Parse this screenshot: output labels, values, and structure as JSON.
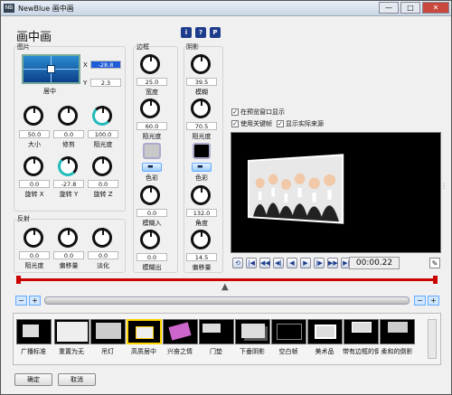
{
  "window": {
    "title": "NewBlue 画中画",
    "buttons": {
      "minimize": "—",
      "maximize": "□",
      "close": "✕"
    }
  },
  "header": {
    "title": "画中画",
    "info": [
      "i",
      "?",
      "P"
    ]
  },
  "picture": {
    "section": "图片",
    "x_label": "X",
    "x_value": "-28.8",
    "y_label": "Y",
    "y_value": "2.3",
    "center_label": "居中",
    "knobs": [
      {
        "value": "50.0",
        "label": "大小"
      },
      {
        "value": "0.0",
        "label": "修剪"
      },
      {
        "value": "100.0",
        "label": "阻光度"
      },
      {
        "value": "0.0",
        "label": "旋转 X"
      },
      {
        "value": "-27.8",
        "label": "旋转 Y"
      },
      {
        "value": "0.0",
        "label": "旋转 Z"
      }
    ]
  },
  "reflection": {
    "section": "反射",
    "knobs": [
      {
        "value": "0.0",
        "label": "阻光度"
      },
      {
        "value": "0.0",
        "label": "偏移量"
      },
      {
        "value": "0.0",
        "label": "淡化"
      }
    ]
  },
  "border": {
    "section": "边框",
    "knobs": [
      {
        "value": "25.0",
        "label": "宽度"
      },
      {
        "value": "60.0",
        "label": "阻光度"
      },
      {
        "value": "0.0",
        "label": "模糊入"
      },
      {
        "value": "0.0",
        "label": "模糊出"
      }
    ],
    "color_label": "色彩",
    "swatch_color": "#c8c8c8"
  },
  "shadow": {
    "section": "阴影",
    "knobs": [
      {
        "value": "39.5",
        "label": "模糊"
      },
      {
        "value": "70.5",
        "label": "阻光度"
      },
      {
        "value": "132.0",
        "label": "角度"
      },
      {
        "value": "14.5",
        "label": "偏移量"
      }
    ],
    "color_label": "色彩",
    "swatch_color": "#000000"
  },
  "options": {
    "show_in_preview": "在预览窗口显示",
    "use_keyframes": "使用关键帧",
    "show_source": "显示实际来源"
  },
  "transport": {
    "timecode": "00:00.22"
  },
  "presets": [
    "广播标准",
    "重置为无",
    "吊灯",
    "高质居中",
    "兴奋之情",
    "门垫",
    "下垂阴影",
    "空白帧",
    "美术品",
    "带有边框的倒影",
    "柔和的倒影"
  ],
  "footer": {
    "ok": "确定",
    "cancel": "取消"
  },
  "colors": {
    "accent": "#1e3c8c",
    "highlight": "#ffd200"
  }
}
